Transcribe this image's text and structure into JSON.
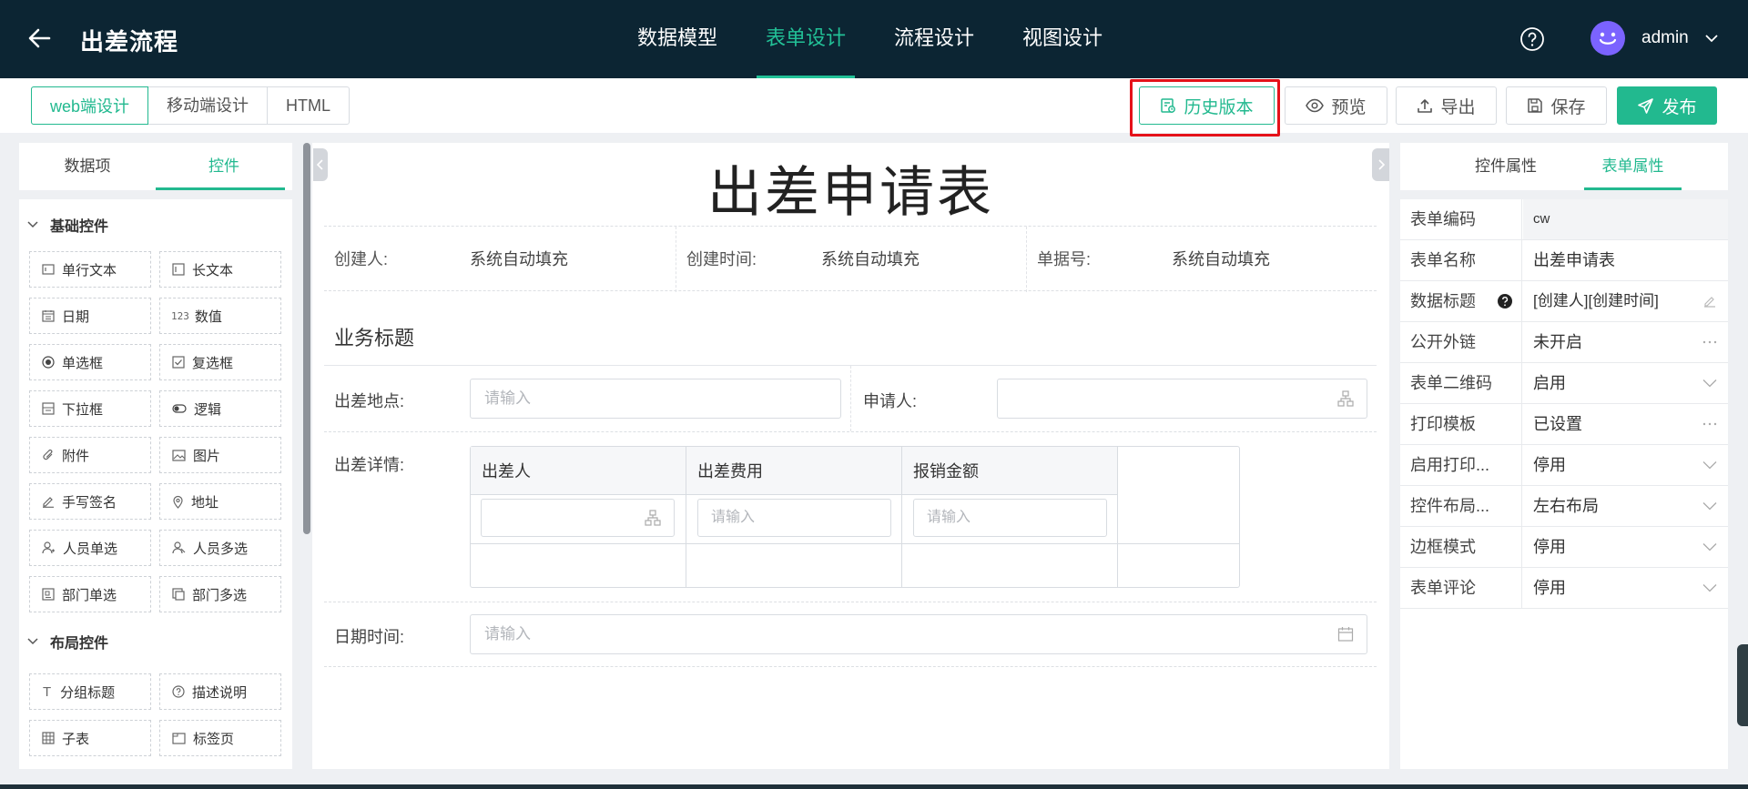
{
  "header": {
    "title": "出差流程",
    "nav": [
      {
        "label": "数据模型",
        "active": false
      },
      {
        "label": "表单设计",
        "active": true
      },
      {
        "label": "流程设计",
        "active": false
      },
      {
        "label": "视图设计",
        "active": false
      }
    ],
    "user": "admin"
  },
  "toolbar": {
    "modes": [
      "web端设计",
      "移动端设计",
      "HTML"
    ],
    "history": "历史版本",
    "preview": "预览",
    "export": "导出",
    "save": "保存",
    "publish": "发布"
  },
  "left_panel": {
    "tabs": [
      "数据项",
      "控件"
    ],
    "basic_title": "基础控件",
    "basic": [
      {
        "label": "单行文本",
        "icon": "single-line-text-icon"
      },
      {
        "label": "长文本",
        "icon": "long-text-icon"
      },
      {
        "label": "日期",
        "icon": "date-icon"
      },
      {
        "label": "数值",
        "icon": "number-icon",
        "glyph": "123"
      },
      {
        "label": "单选框",
        "icon": "radio-icon"
      },
      {
        "label": "复选框",
        "icon": "checkbox-icon"
      },
      {
        "label": "下拉框",
        "icon": "dropdown-icon"
      },
      {
        "label": "逻辑",
        "icon": "toggle-icon"
      },
      {
        "label": "附件",
        "icon": "paperclip-icon"
      },
      {
        "label": "图片",
        "icon": "image-icon"
      },
      {
        "label": "手写签名",
        "icon": "pen-icon"
      },
      {
        "label": "地址",
        "icon": "location-icon"
      },
      {
        "label": "人员单选",
        "icon": "user-single-icon"
      },
      {
        "label": "人员多选",
        "icon": "user-multi-icon"
      },
      {
        "label": "部门单选",
        "icon": "dept-single-icon"
      },
      {
        "label": "部门多选",
        "icon": "dept-multi-icon"
      }
    ],
    "layout_title": "布局控件",
    "layout": [
      {
        "label": "分组标题",
        "icon": "heading-icon",
        "glyph": "T"
      },
      {
        "label": "描述说明",
        "icon": "help-circle-icon"
      },
      {
        "label": "子表",
        "icon": "grid-icon"
      },
      {
        "label": "标签页",
        "icon": "tabs-icon"
      }
    ]
  },
  "canvas": {
    "form_title": "出差申请表",
    "meta": [
      {
        "label": "创建人:",
        "value": "系统自动填充"
      },
      {
        "label": "创建时间:",
        "value": "系统自动填充"
      },
      {
        "label": "单据号:",
        "value": "系统自动填充"
      }
    ],
    "group_title": "业务标题",
    "fields": {
      "location_label": "出差地点:",
      "location_placeholder": "请输入",
      "applicant_label": "申请人:",
      "detail_label": "出差详情:",
      "datetime_label": "日期时间:",
      "datetime_placeholder": "请输入"
    },
    "subtable": {
      "columns": [
        "出差人",
        "出差费用",
        "报销金额"
      ],
      "placeholder": "请输入"
    }
  },
  "right_panel": {
    "tabs": [
      "控件属性",
      "表单属性"
    ],
    "props": [
      {
        "key": "表单编码",
        "value": "cw",
        "kind": "input"
      },
      {
        "key": "表单名称",
        "value": "出差申请表",
        "kind": "text"
      },
      {
        "key": "数据标题",
        "value": "[创建人][创建时间]",
        "kind": "edit"
      },
      {
        "key": "公开外链",
        "value": "未开启",
        "kind": "more"
      },
      {
        "key": "表单二维码",
        "value": "启用",
        "kind": "select"
      },
      {
        "key": "打印模板",
        "value": "已设置",
        "kind": "more"
      },
      {
        "key": "启用打印...",
        "value": "停用",
        "kind": "select"
      },
      {
        "key": "控件布局...",
        "value": "左右布局",
        "kind": "select"
      },
      {
        "key": "边框模式",
        "value": "停用",
        "kind": "select"
      },
      {
        "key": "表单评论",
        "value": "停用",
        "kind": "select"
      }
    ]
  },
  "colors": {
    "header_bg": "#0c2533",
    "accent": "#22b98f",
    "highlight": "#e5121a"
  }
}
